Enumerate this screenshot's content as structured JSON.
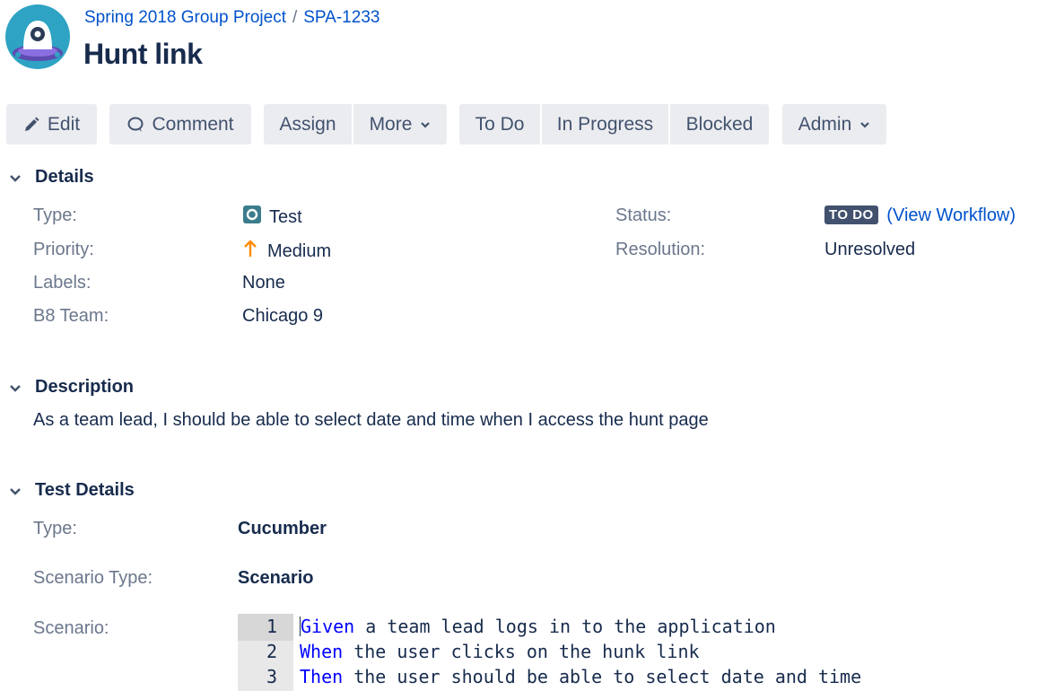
{
  "header": {
    "project": "Spring 2018 Group Project",
    "separator": "/",
    "issue_key": "SPA-1233",
    "title": "Hunt link"
  },
  "toolbar": {
    "edit": "Edit",
    "comment": "Comment",
    "assign": "Assign",
    "more": "More",
    "todo": "To Do",
    "in_progress": "In Progress",
    "blocked": "Blocked",
    "admin": "Admin"
  },
  "details": {
    "heading": "Details",
    "type_label": "Type:",
    "type_value": "Test",
    "priority_label": "Priority:",
    "priority_value": "Medium",
    "labels_label": "Labels:",
    "labels_value": "None",
    "team_label": "B8 Team:",
    "team_value": "Chicago 9",
    "status_label": "Status:",
    "status_value": "TO DO",
    "view_workflow": "View Workflow",
    "paren_open": "(",
    "paren_close": ")",
    "resolution_label": "Resolution:",
    "resolution_value": "Unresolved"
  },
  "description": {
    "heading": "Description",
    "text": "As a team lead, I should be able to select date and time when I access the hunt page"
  },
  "test_details": {
    "heading": "Test Details",
    "type_label": "Type:",
    "type_value": "Cucumber",
    "scenario_type_label": "Scenario Type:",
    "scenario_type_value": "Scenario",
    "scenario_label": "Scenario:",
    "lines": [
      {
        "num": "1",
        "keyword": "Given",
        "rest": " a team lead logs in to the application"
      },
      {
        "num": "2",
        "keyword": "When",
        "rest": " the user clicks on the hunk link"
      },
      {
        "num": "3",
        "keyword": "Then",
        "rest": " the user should be able to select date and time"
      }
    ]
  },
  "colors": {
    "link": "#0052cc",
    "button_bg": "#ebecf0",
    "status_lozenge": "#42526e",
    "priority_arrow": "#ff8b00",
    "test_icon": "#3b7c8c",
    "gherkin_keyword": "#0000ff"
  },
  "icons": {
    "avatar": "project-avatar-icon",
    "edit": "pencil-icon",
    "comment": "speech-bubble-icon",
    "chevron": "chevron-down-icon",
    "type": "test-issue-type-icon",
    "priority": "arrow-up-icon"
  }
}
